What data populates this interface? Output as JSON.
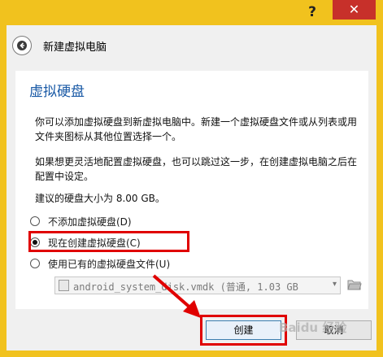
{
  "titlebar": {
    "help_label": "?",
    "close_label": "✕"
  },
  "wizard": {
    "title": "新建虚拟电脑"
  },
  "panel": {
    "section_title": "虚拟硬盘",
    "paragraph1": "你可以添加虚拟硬盘到新虚拟电脑中。新建一个虚拟硬盘文件或从列表或用文件夹图标从其他位置选择一个。",
    "paragraph2": "如果想更灵活地配置虚拟硬盘，也可以跳过这一步，在创建虚拟电脑之后在配置中设定。",
    "recommended": "建议的硬盘大小为 8.00 GB。",
    "options": [
      {
        "label": "不添加虚拟硬盘(D)",
        "checked": false
      },
      {
        "label": "现在创建虚拟硬盘(C)",
        "checked": true
      },
      {
        "label": "使用已有的虚拟硬盘文件(U)",
        "checked": false
      }
    ],
    "existing_file": {
      "value": "android_system_disk.vmdk (普通, 1.03 GB",
      "dropdown": "▾"
    }
  },
  "footer": {
    "create_label": "创建",
    "cancel_label": "取消"
  },
  "watermark": "Baidu 经验",
  "colors": {
    "accent_frame": "#f1c21e",
    "close_red": "#c7302a",
    "section_blue": "#1a5aa6",
    "annotation_red": "#e00000"
  }
}
